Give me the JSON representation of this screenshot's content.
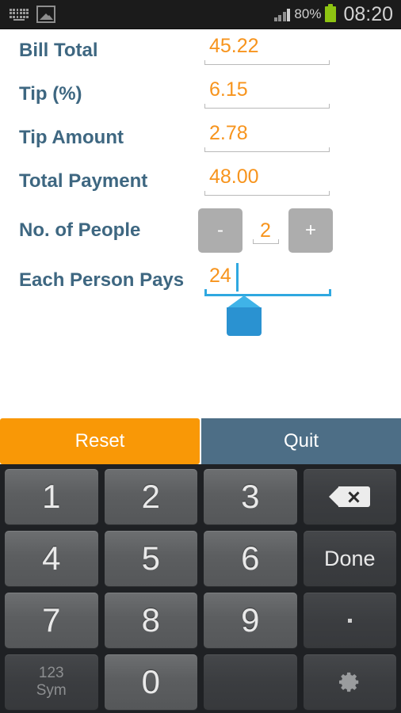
{
  "status_bar": {
    "left_icons": [
      "keyboard-icon",
      "picture-icon"
    ],
    "signal_icon": "signal-bars-icon",
    "battery_percent": "80%",
    "battery_icon": "battery-icon",
    "clock": "08:20",
    "background_color": "#1b1b1b"
  },
  "theme": {
    "label_color": "#3e6781",
    "value_color": "#f7941d",
    "focus_color": "#2fa8e0",
    "reset_color": "#f99806",
    "quit_color": "#4d6e86"
  },
  "form": {
    "rows": [
      {
        "label": "Bill Total",
        "value": "45.22"
      },
      {
        "label": "Tip (%)",
        "value": "6.15"
      },
      {
        "label": "Tip Amount",
        "value": "2.78"
      },
      {
        "label": "Total Payment",
        "value": "48.00"
      }
    ],
    "people": {
      "label": "No. of People",
      "minus_label": "-",
      "plus_label": "+",
      "value": "2"
    },
    "each_person": {
      "label": "Each Person Pays",
      "value": "24"
    }
  },
  "actions": {
    "reset_label": "Reset",
    "quit_label": "Quit"
  },
  "keyboard": {
    "rows": [
      [
        {
          "label": "1",
          "type": "num"
        },
        {
          "label": "2",
          "type": "num"
        },
        {
          "label": "3",
          "type": "num"
        },
        {
          "label": "",
          "type": "backspace"
        }
      ],
      [
        {
          "label": "4",
          "type": "num"
        },
        {
          "label": "5",
          "type": "num"
        },
        {
          "label": "6",
          "type": "num"
        },
        {
          "label": "Done",
          "type": "fn"
        }
      ],
      [
        {
          "label": "7",
          "type": "num"
        },
        {
          "label": "8",
          "type": "num"
        },
        {
          "label": "9",
          "type": "num"
        },
        {
          "label": ".",
          "type": "dot"
        }
      ],
      [
        {
          "label": "123",
          "label2": "Sym",
          "type": "sym"
        },
        {
          "label": "0",
          "type": "num"
        },
        {
          "label": "",
          "type": "blank"
        },
        {
          "label": "",
          "type": "settings"
        }
      ]
    ]
  }
}
